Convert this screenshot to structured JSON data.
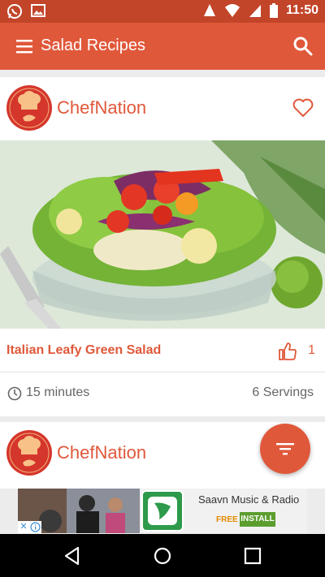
{
  "status_bar": {
    "time": "11:50",
    "left_icons": [
      "whatsapp-icon",
      "image-icon"
    ],
    "right_icons": [
      "alarm-icon",
      "wifi-icon",
      "cell-signal-icon",
      "battery-icon"
    ]
  },
  "app_bar": {
    "title": "Salad Recipes",
    "menu_icon": "menu-icon",
    "search_icon": "search-icon",
    "color": "#e0583a"
  },
  "cards": [
    {
      "brand": "ChefNation",
      "recipe_title": "Italian Leafy Green Salad",
      "likes": "1",
      "duration": "15 minutes",
      "servings": "6 Servings"
    },
    {
      "brand": "ChefNation"
    }
  ],
  "ad": {
    "app_name": "Saavn Music & Radio",
    "price": "FREE",
    "install_label": "INSTALL",
    "close": "✕"
  },
  "colors": {
    "status_bar": "#c2452a",
    "accent": "#e0583a",
    "text_muted": "#666666"
  }
}
